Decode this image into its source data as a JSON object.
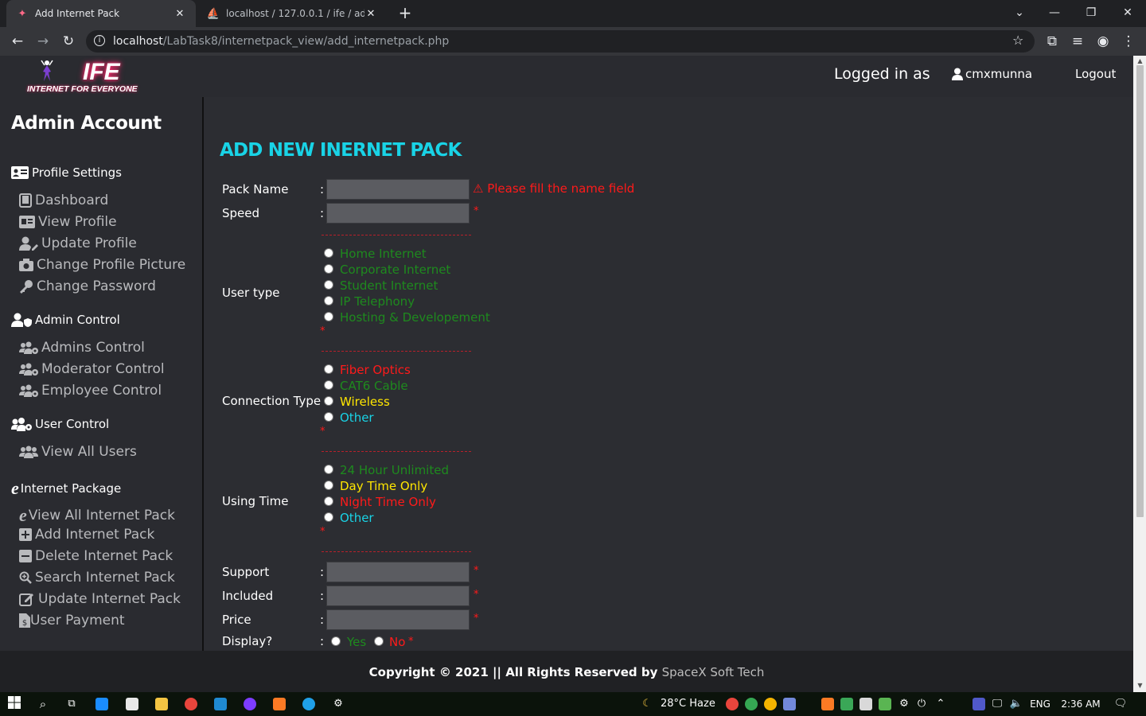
{
  "browser": {
    "tabs": [
      {
        "title": "Add Internet Pack",
        "icon": "ife-favicon-icon"
      },
      {
        "title": "localhost / 127.0.0.1 / ife / admin",
        "icon": "phpmyadmin-icon"
      }
    ],
    "url_host": "localhost",
    "url_path": "/LabTask8/internetpack_view/add_internetpack.php"
  },
  "header": {
    "logo_title": "IFE",
    "logo_subtitle": "INTERNET FOR EVERYONE",
    "logged_in_label": "Logged in as",
    "username": "cmxmunna",
    "logout_label": "Logout"
  },
  "sidebar": {
    "title": "Admin Account",
    "sections": [
      {
        "heading": "Profile Settings",
        "icon": "id-card-icon",
        "items": [
          {
            "label": "Dashboard",
            "icon": "tablet-icon"
          },
          {
            "label": "View Profile",
            "icon": "profile-card-icon"
          },
          {
            "label": "Update Profile",
            "icon": "user-edit-icon"
          },
          {
            "label": "Change Profile Picture",
            "icon": "camera-icon"
          },
          {
            "label": "Change Password",
            "icon": "key-icon"
          }
        ]
      },
      {
        "heading": "Admin Control",
        "icon": "user-shield-icon",
        "items": [
          {
            "label": "Admins Control",
            "icon": "users-cog-icon"
          },
          {
            "label": "Moderator Control",
            "icon": "users-cog-icon"
          },
          {
            "label": "Employee Control",
            "icon": "users-cog-icon"
          }
        ]
      },
      {
        "heading": "User Control",
        "icon": "users-cog-icon",
        "items": [
          {
            "label": "View All Users",
            "icon": "users-icon"
          }
        ]
      },
      {
        "heading": "Internet Package",
        "icon": "internet-explorer-icon",
        "items": [
          {
            "label": "View All Internet Pack",
            "icon": "internet-explorer-icon"
          },
          {
            "label": "Add Internet Pack",
            "icon": "plus-square-icon"
          },
          {
            "label": "Delete Internet Pack",
            "icon": "minus-square-icon"
          },
          {
            "label": "Search Internet Pack",
            "icon": "search-plus-icon"
          },
          {
            "label": "Update Internet Pack",
            "icon": "edit-icon"
          },
          {
            "label": "User Payment",
            "icon": "file-invoice-dollar-icon"
          }
        ]
      }
    ]
  },
  "form": {
    "title": "ADD NEW INERNET PACK",
    "colon": ":",
    "required_mark": "*",
    "pack_name_label": "Pack Name",
    "pack_name_error": "⚠ Please fill the name field",
    "speed_label": "Speed",
    "user_type_label": "User type",
    "user_type_options": [
      "Home Internet",
      "Corporate Internet",
      "Student Internet",
      "IP Telephony",
      "Hosting & Developement"
    ],
    "connection_type_label": "Connection Type",
    "connection_type_options": [
      "Fiber Optics",
      "CAT6 Cable",
      "Wireless",
      "Other"
    ],
    "using_time_label": "Using Time",
    "using_time_options": [
      "24 Hour Unlimited",
      "Day Time Only",
      "Night Time Only",
      "Other"
    ],
    "support_label": "Support",
    "included_label": "Included",
    "price_label": "Price",
    "display_label": "Display?",
    "display_options": [
      "Yes",
      "No"
    ],
    "colors": {
      "green": "#1e8a1e",
      "red": "#ff1a1a",
      "yellow": "#ffe600",
      "cyan": "#19d3e6"
    }
  },
  "footer": {
    "copyright": "Copyright © 2021 || All Rights Reserved by",
    "company": "SpaceX Soft Tech"
  },
  "taskbar": {
    "weather": "28°C  Haze",
    "language": "ENG",
    "time": "2:36 AM"
  }
}
